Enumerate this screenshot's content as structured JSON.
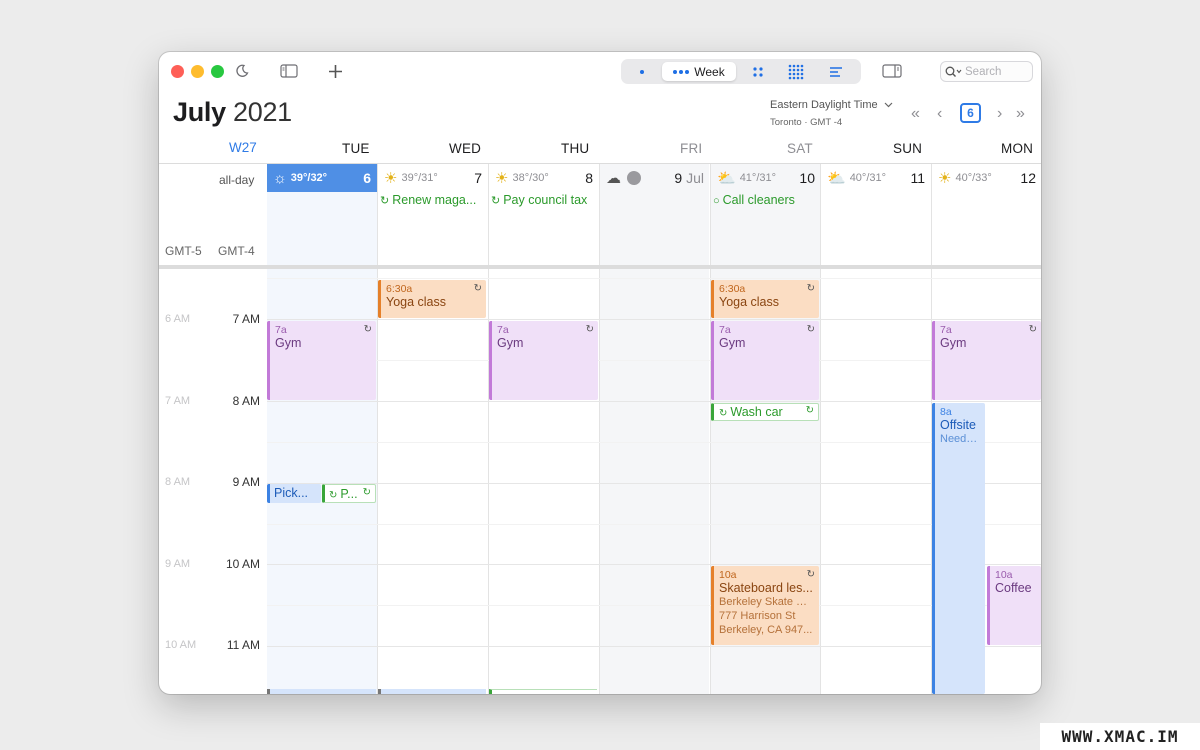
{
  "toolbar": {
    "view_week_label": "Week",
    "search_placeholder": "Search"
  },
  "header": {
    "month": "July",
    "year": "2021",
    "timezone_name": "Eastern Daylight Time",
    "timezone_detail": "Toronto · GMT -4",
    "today_day": "6",
    "week_number": "W27"
  },
  "days": [
    {
      "label": "TUE",
      "temp": "39°/32°",
      "num": "6",
      "weather": "sun",
      "color": "#1d1d1f"
    },
    {
      "label": "WED",
      "temp": "39°/31°",
      "num": "7",
      "weather": "sun",
      "color": "#1d1d1f"
    },
    {
      "label": "THU",
      "temp": "38°/30°",
      "num": "8",
      "weather": "sun",
      "color": "#1d1d1f"
    },
    {
      "label": "FRI",
      "temp": "",
      "num": "9",
      "month_suffix": "Jul",
      "weather": "cloud-moon",
      "color": "#8e8e93"
    },
    {
      "label": "SAT",
      "temp": "41°/31°",
      "num": "10",
      "weather": "cloud-sun",
      "color": "#8e8e93"
    },
    {
      "label": "SUN",
      "temp": "40°/31°",
      "num": "11",
      "weather": "cloud-sun",
      "color": "#1d1d1f"
    },
    {
      "label": "MON",
      "temp": "40°/33°",
      "num": "12",
      "weather": "sun",
      "color": "#1d1d1f"
    }
  ],
  "allday": {
    "label": "all-day",
    "gmt_left": "GMT-5",
    "gmt_right": "GMT-4",
    "tasks": [
      {
        "text": "Renew maga..."
      },
      {
        "text": "Pay council tax"
      },
      {
        "text": "Call cleaners"
      }
    ]
  },
  "times": {
    "primary": [
      "7 AM",
      "8 AM",
      "9 AM",
      "10 AM",
      "11 AM"
    ],
    "secondary": [
      "6 AM",
      "7 AM",
      "8 AM",
      "9 AM",
      "10 AM"
    ]
  },
  "events": {
    "yoga_wed": {
      "time": "6:30a",
      "title": "Yoga class"
    },
    "yoga_sat": {
      "time": "6:30a",
      "title": "Yoga class"
    },
    "gym_tue": {
      "time": "7a",
      "title": "Gym"
    },
    "gym_thu": {
      "time": "7a",
      "title": "Gym"
    },
    "gym_sat": {
      "time": "7a",
      "title": "Gym"
    },
    "gym_mon": {
      "time": "7a",
      "title": "Gym"
    },
    "wash_car": {
      "title": "Wash car"
    },
    "offsite": {
      "time": "8a",
      "title": "Offsite",
      "note": "Need t..."
    },
    "pick": {
      "title": "Pick..."
    },
    "p_task": {
      "title": "P..."
    },
    "skateboard": {
      "time": "10a",
      "title": "Skateboard les...",
      "line1": "Berkeley Skate Pa...",
      "line2": "777 Harrison St",
      "line3": "Berkeley, CA  947..."
    },
    "coffee": {
      "time": "10a",
      "title": "Coffee"
    }
  },
  "watermark": "WWW.XMAC.IM"
}
